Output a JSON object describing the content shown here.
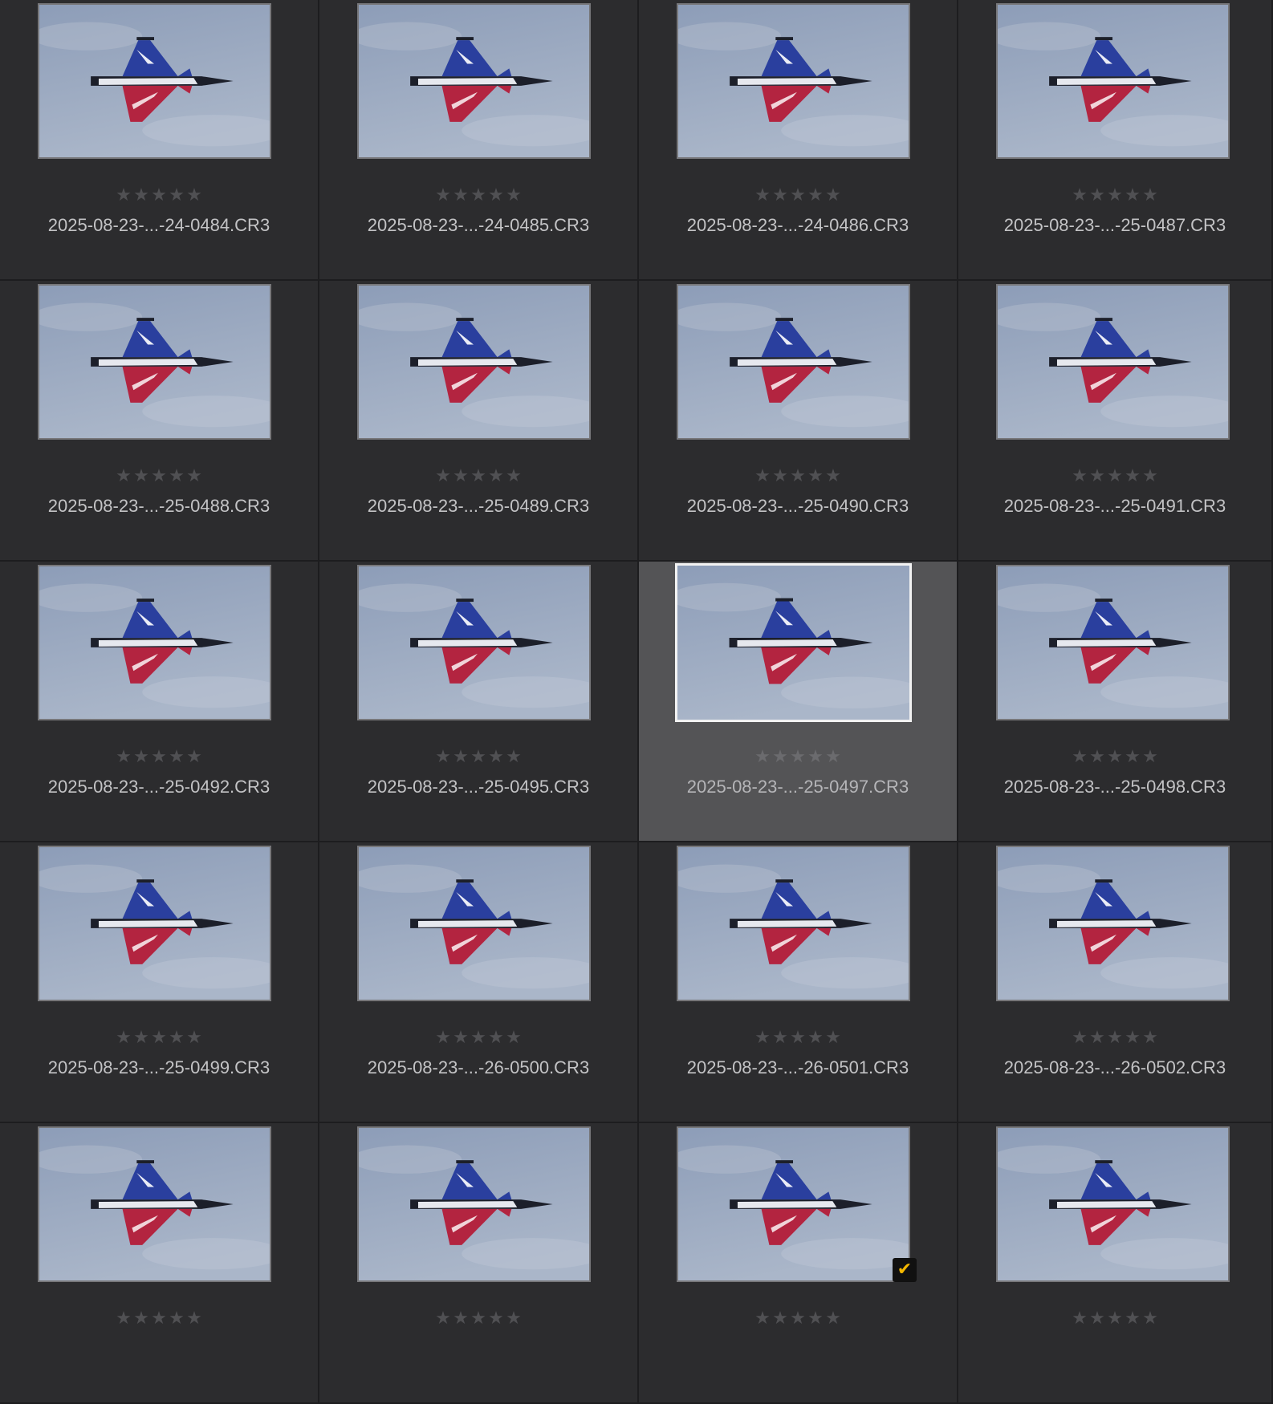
{
  "colors": {
    "background": "#2c2c2e",
    "selected_background": "#545456",
    "star_inactive": "#505053",
    "filename_text": "#c3c3c5",
    "checkmark": "#f5b800"
  },
  "photos": [
    {
      "filename": "2025-08-23-...-24-0484.CR3",
      "rating": 0,
      "selected": false,
      "checked": false
    },
    {
      "filename": "2025-08-23-...-24-0485.CR3",
      "rating": 0,
      "selected": false,
      "checked": false
    },
    {
      "filename": "2025-08-23-...-24-0486.CR3",
      "rating": 0,
      "selected": false,
      "checked": false
    },
    {
      "filename": "2025-08-23-...-25-0487.CR3",
      "rating": 0,
      "selected": false,
      "checked": false
    },
    {
      "filename": "2025-08-23-...-25-0488.CR3",
      "rating": 0,
      "selected": false,
      "checked": false
    },
    {
      "filename": "2025-08-23-...-25-0489.CR3",
      "rating": 0,
      "selected": false,
      "checked": false
    },
    {
      "filename": "2025-08-23-...-25-0490.CR3",
      "rating": 0,
      "selected": false,
      "checked": false
    },
    {
      "filename": "2025-08-23-...-25-0491.CR3",
      "rating": 0,
      "selected": false,
      "checked": false
    },
    {
      "filename": "2025-08-23-...-25-0492.CR3",
      "rating": 0,
      "selected": false,
      "checked": false
    },
    {
      "filename": "2025-08-23-...-25-0495.CR3",
      "rating": 0,
      "selected": false,
      "checked": false
    },
    {
      "filename": "2025-08-23-...-25-0497.CR3",
      "rating": 0,
      "selected": true,
      "checked": false
    },
    {
      "filename": "2025-08-23-...-25-0498.CR3",
      "rating": 0,
      "selected": false,
      "checked": false
    },
    {
      "filename": "2025-08-23-...-25-0499.CR3",
      "rating": 0,
      "selected": false,
      "checked": false
    },
    {
      "filename": "2025-08-23-...-26-0500.CR3",
      "rating": 0,
      "selected": false,
      "checked": false
    },
    {
      "filename": "2025-08-23-...-26-0501.CR3",
      "rating": 0,
      "selected": false,
      "checked": false
    },
    {
      "filename": "2025-08-23-...-26-0502.CR3",
      "rating": 0,
      "selected": false,
      "checked": false
    },
    {
      "filename": "",
      "rating": 0,
      "selected": false,
      "checked": false
    },
    {
      "filename": "",
      "rating": 0,
      "selected": false,
      "checked": false
    },
    {
      "filename": "",
      "rating": 0,
      "selected": false,
      "checked": true
    },
    {
      "filename": "",
      "rating": 0,
      "selected": false,
      "checked": false
    }
  ],
  "icons": {
    "star": "★",
    "check": "✔"
  }
}
